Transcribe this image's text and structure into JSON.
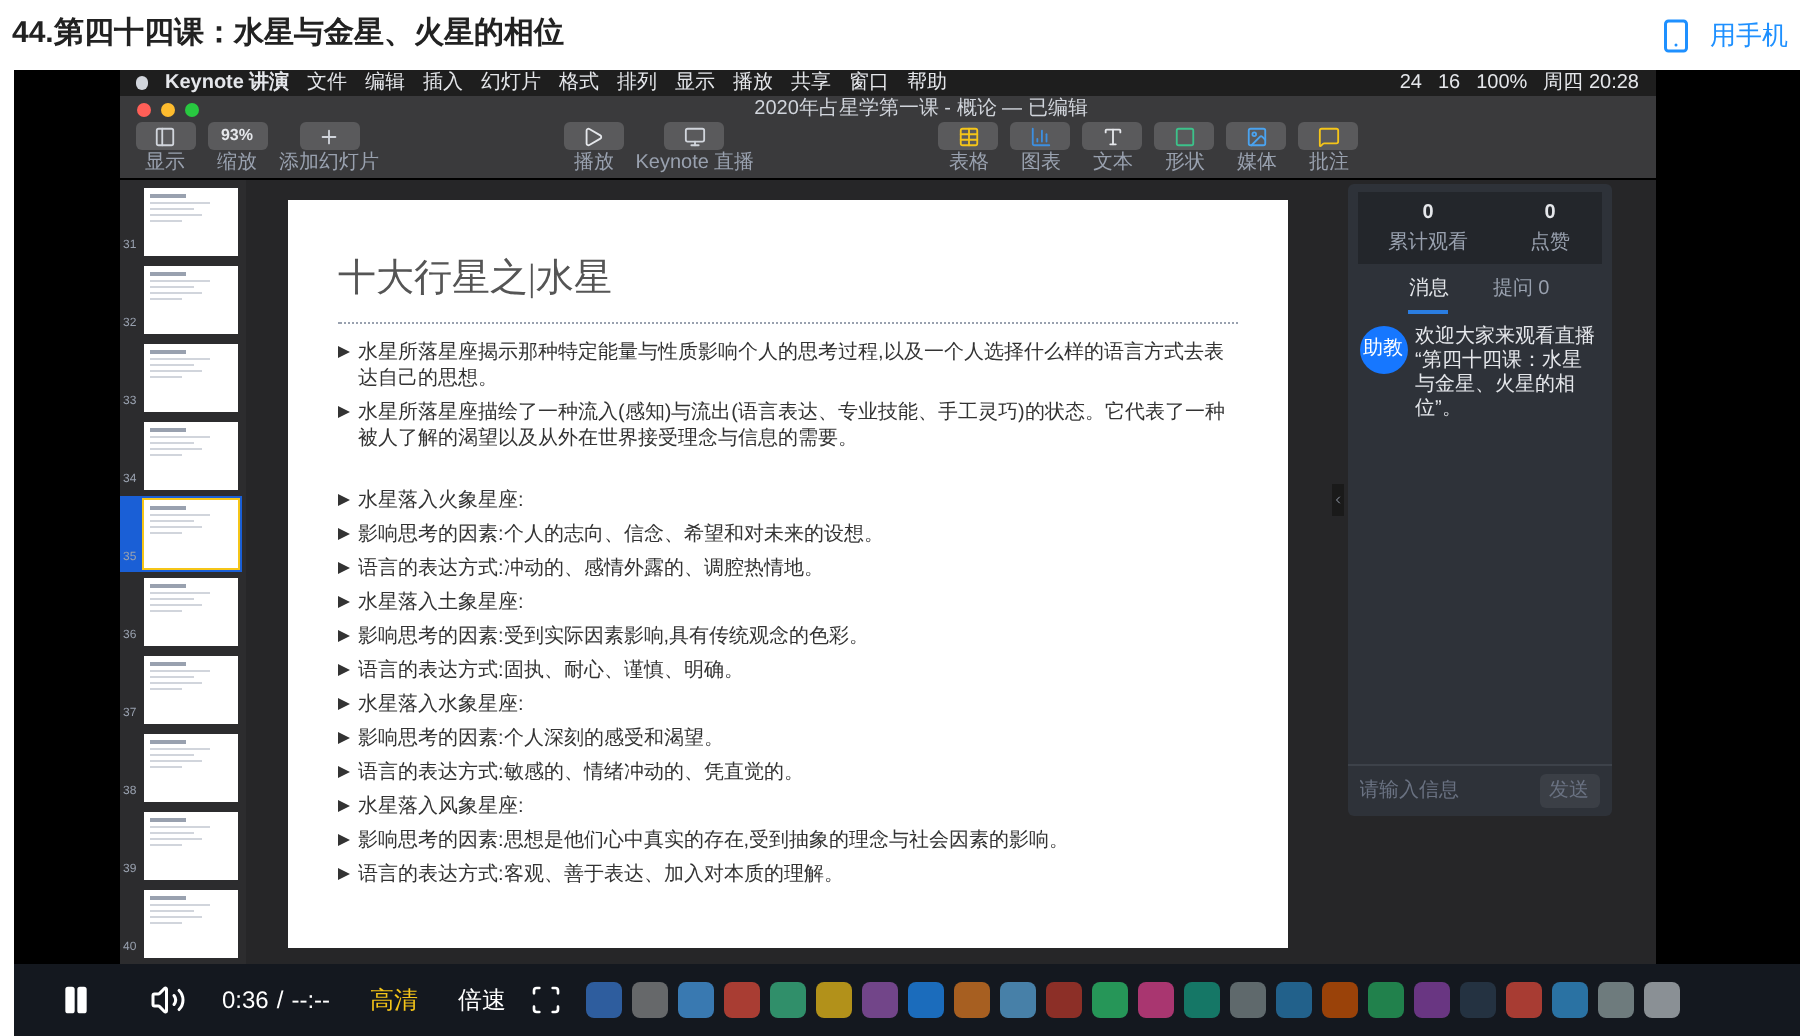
{
  "page": {
    "title": "44.第四十四课：水星与金星、火星的相位",
    "mobile_link": "用手机"
  },
  "menu_bar": {
    "items": [
      "Keynote 讲演",
      "文件",
      "编辑",
      "插入",
      "幻灯片",
      "格式",
      "排列",
      "显示",
      "播放",
      "共享",
      "窗口",
      "帮助"
    ],
    "status": [
      "24",
      "16",
      "100%",
      "周四 20:28"
    ]
  },
  "window": {
    "title": "2020年占星学第一课 - 概论 — 已编辑"
  },
  "toolbar": [
    {
      "kind": "view",
      "label": "显示"
    },
    {
      "kind": "zoom",
      "label": "缩放",
      "value": "93%"
    },
    {
      "kind": "add",
      "label": "添加幻灯片"
    },
    {
      "kind": "play",
      "label": "播放"
    },
    {
      "kind": "live",
      "label": "Keynote 直播"
    },
    {
      "kind": "table",
      "label": "表格"
    },
    {
      "kind": "chart",
      "label": "图表"
    },
    {
      "kind": "text",
      "label": "文本"
    },
    {
      "kind": "shape",
      "label": "形状"
    },
    {
      "kind": "media",
      "label": "媒体"
    },
    {
      "kind": "comment",
      "label": "批注"
    }
  ],
  "slides": [
    {
      "number": "31",
      "selected": false
    },
    {
      "number": "32",
      "selected": false
    },
    {
      "number": "33",
      "selected": false
    },
    {
      "number": "34",
      "selected": false
    },
    {
      "number": "35",
      "selected": true
    },
    {
      "number": "36",
      "selected": false
    },
    {
      "number": "37",
      "selected": false
    },
    {
      "number": "38",
      "selected": false
    },
    {
      "number": "39",
      "selected": false
    },
    {
      "number": "40",
      "selected": false
    }
  ],
  "slide": {
    "title": "十大行星之|水星",
    "bullets": [
      {
        "text": "水星所落星座揭示那种特定能量与性质影响个人的思考过程,以及一个人选择什么样的语言方式去表达自己的思想。",
        "gap_before": false
      },
      {
        "text": "水星所落星座描绘了一种流入(感知)与流出(语言表达、专业技能、手工灵巧)的状态。它代表了一种被人了解的渴望以及从外在世界接受理念与信息的需要。",
        "gap_before": false
      },
      {
        "text": "水星落入火象星座:",
        "gap_before": true
      },
      {
        "text": "影响思考的因素:个人的志向、信念、希望和对未来的设想。",
        "gap_before": false
      },
      {
        "text": "语言的表达方式:冲动的、感情外露的、调腔热情地。",
        "gap_before": false
      },
      {
        "text": "水星落入土象星座:",
        "gap_before": false
      },
      {
        "text": "影响思考的因素:受到实际因素影响,具有传统观念的色彩。",
        "gap_before": false
      },
      {
        "text": "语言的表达方式:固执、耐心、谨慎、明确。",
        "gap_before": false
      },
      {
        "text": "水星落入水象星座:",
        "gap_before": false
      },
      {
        "text": "影响思考的因素:个人深刻的感受和渴望。",
        "gap_before": false
      },
      {
        "text": "语言的表达方式:敏感的、情绪冲动的、凭直觉的。",
        "gap_before": false
      },
      {
        "text": "水星落入风象星座:",
        "gap_before": false
      },
      {
        "text": "影响思考的因素:思想是他们心中真实的存在,受到抽象的理念与社会因素的影响。",
        "gap_before": false
      },
      {
        "text": "语言的表达方式:客观、善于表达、加入对本质的理解。",
        "gap_before": false
      }
    ]
  },
  "chat": {
    "stats": [
      {
        "value": "0",
        "label": "累计观看"
      },
      {
        "value": "0",
        "label": "点赞"
      }
    ],
    "tabs": [
      {
        "label": "消息",
        "selected": true
      },
      {
        "label": "提问 0",
        "selected": false
      }
    ],
    "messages": [
      {
        "avatar": "助教",
        "text": "欢迎大家来观看直播 “第四十四课：水星与金星、火星的相位”。"
      }
    ],
    "input": {
      "placeholder": "请输入信息"
    },
    "send": "发送"
  },
  "player": {
    "playing": true,
    "time": "0:36",
    "separator": "/",
    "duration": "--:--",
    "quality": "高清",
    "speed": "倍速"
  }
}
